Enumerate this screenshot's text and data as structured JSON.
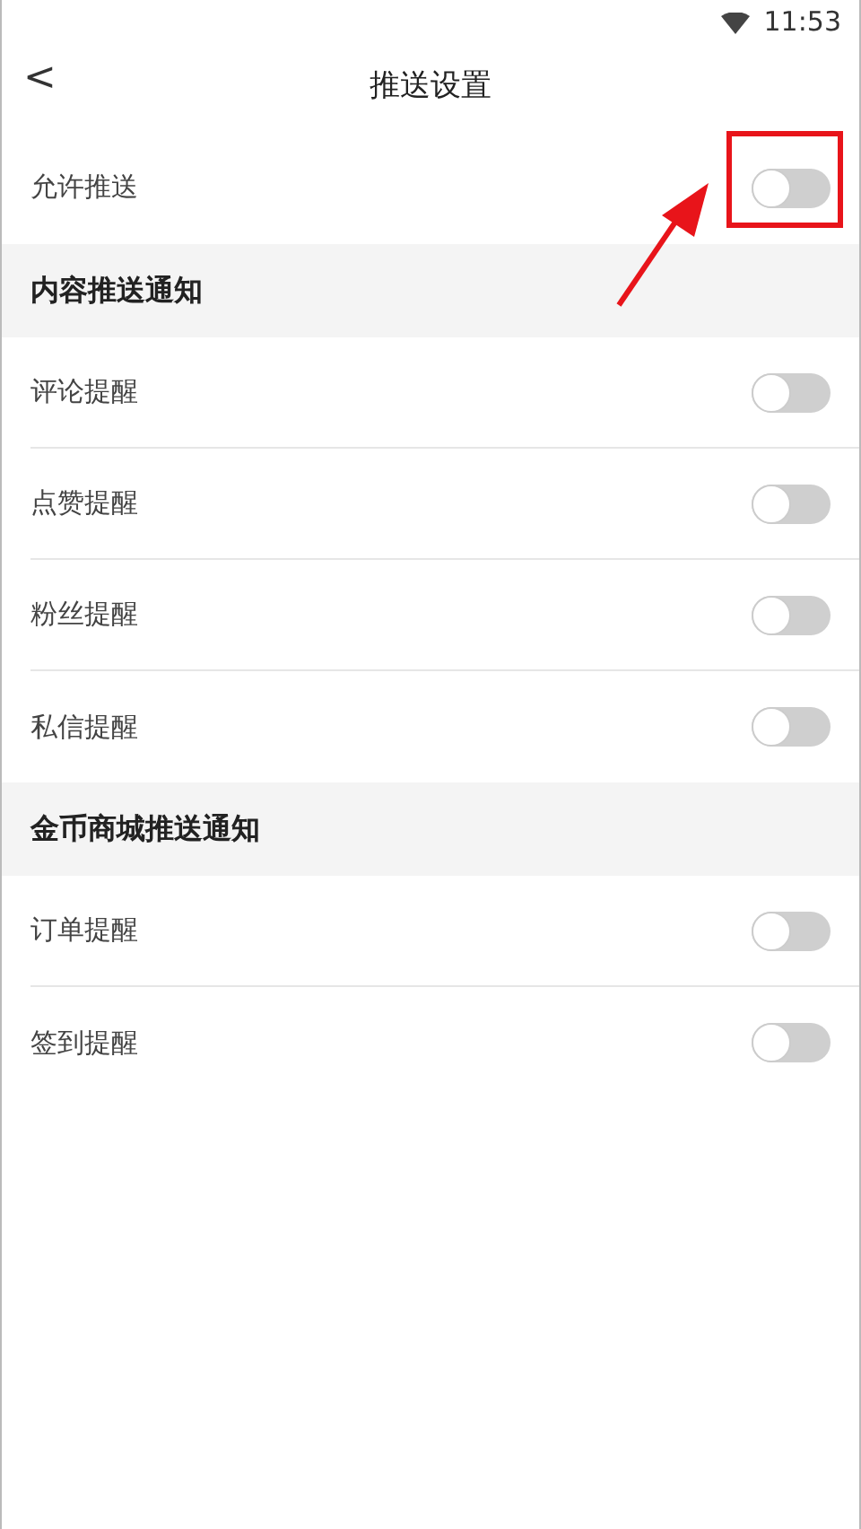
{
  "status_bar": {
    "time": "11:53"
  },
  "header": {
    "back": "<",
    "title": "推送设置"
  },
  "master": {
    "label": "允许推送",
    "on": false,
    "highlighted": true
  },
  "sections": [
    {
      "title": "内容推送通知",
      "items": [
        {
          "label": "评论提醒",
          "on": false
        },
        {
          "label": "点赞提醒",
          "on": false
        },
        {
          "label": "粉丝提醒",
          "on": false
        },
        {
          "label": "私信提醒",
          "on": false
        }
      ]
    },
    {
      "title": "金币商城推送通知",
      "items": [
        {
          "label": "订单提醒",
          "on": false
        },
        {
          "label": "签到提醒",
          "on": false
        }
      ]
    }
  ]
}
